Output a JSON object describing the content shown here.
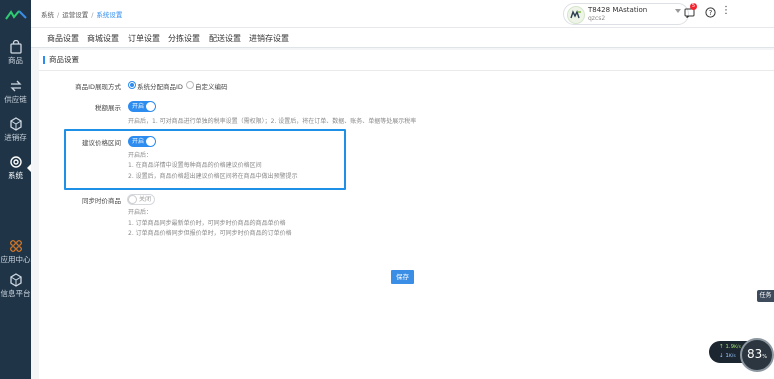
{
  "sidebar": {
    "items": [
      {
        "label": "商品",
        "icon": "shopping-bag-icon"
      },
      {
        "label": "供应链",
        "icon": "supply-chain-icon"
      },
      {
        "label": "进销存",
        "icon": "inventory-icon"
      },
      {
        "label": "系统",
        "icon": "gear-icon",
        "active": true
      },
      {
        "label": "应用中心",
        "icon": "app-center-icon"
      },
      {
        "label": "信息平台",
        "icon": "cube-icon"
      }
    ]
  },
  "breadcrumb": [
    "系统",
    "运营设置",
    "系统设置"
  ],
  "user": {
    "name": "T8428 MAstation",
    "account": "qzcs2",
    "avatar_text": "MT"
  },
  "notifications": {
    "count": "5"
  },
  "tabs": [
    "商品设置",
    "商城设置",
    "订单设置",
    "分拣设置",
    "配送设置",
    "进销存设置"
  ],
  "section_title": "商品设置",
  "settings": {
    "id_mode": {
      "label": "商品ID展现方式",
      "options": [
        "系统分配商品ID",
        "自定义编码"
      ],
      "selected": "系统分配商品ID"
    },
    "tax": {
      "label": "税额展示",
      "switch": "开启",
      "hint": "开启后，1. 可对商品进行单独的税率设置（需权限）；2. 设置后，将在订单、数据、账务、单据等处展示税率"
    },
    "suggested_price": {
      "label": "建议价格区间",
      "switch": "开启",
      "hints": [
        "开启后：",
        "1. 在商品详情中设置每种商品的价格建议价格区间",
        "2. 设置后，商品价格超出建议价格区间将在商品中做出预警提示"
      ]
    },
    "sync_price": {
      "label": "同步时价商品",
      "switch": "关闭",
      "hints": [
        "开启后：",
        "1. 订单商品同步最新单价时，可同步时价商品的商品单价格",
        "2. 订单商品价格同步但报价单时，可同步时价商品的订单价格"
      ]
    }
  },
  "save_label": "保存",
  "float": {
    "task": "任务",
    "speed_up": "1.9",
    "speed_up_unit": "K/s",
    "speed_down": "1",
    "speed_down_unit": "K/s",
    "gauge": "83",
    "gauge_unit": "%"
  },
  "colors": {
    "sidebar": "#1f3447",
    "accent": "#2d8cf0",
    "highlight": "#1e90e6"
  }
}
